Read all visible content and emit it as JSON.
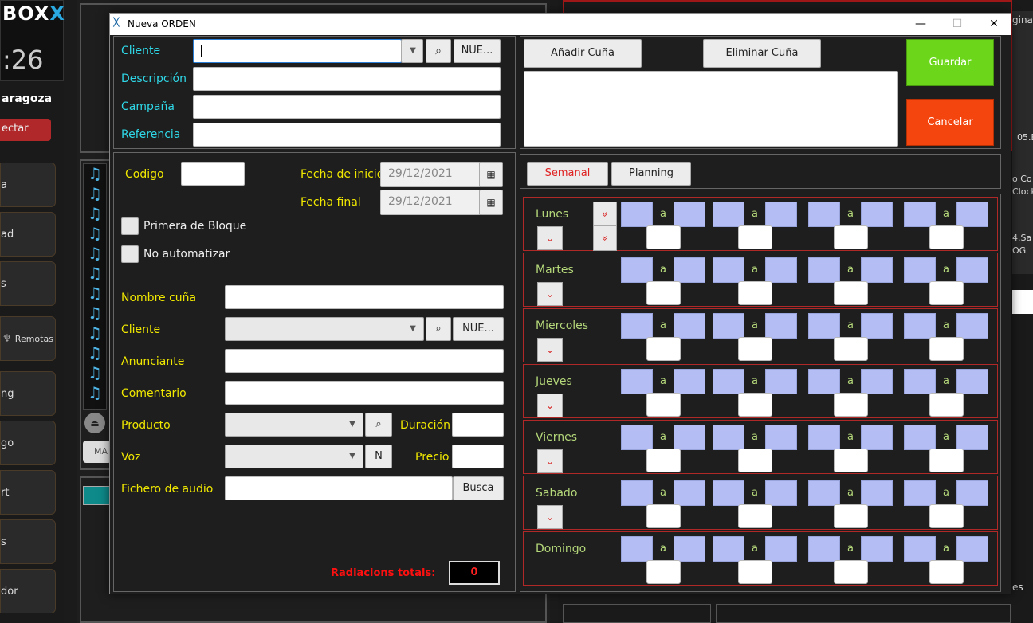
{
  "background": {
    "brand": "BOX",
    "brand_x": "X",
    "clock": ":26",
    "city": "aragoza",
    "connect": "ectar",
    "nav_items": [
      "a",
      "ad",
      "s",
      "Remotas",
      "ng",
      "go",
      "rt",
      "s",
      "dor"
    ],
    "right_texts": [
      "gina",
      "05.E",
      "o Co",
      "Clock",
      "4.Sa",
      "OG",
      "es"
    ],
    "ma_label": "MA"
  },
  "dialog": {
    "title": "Nueva ORDEN",
    "controls": {
      "minimize": "—",
      "maximize": "☐",
      "close": "✕"
    },
    "top": {
      "cliente_label": "Cliente",
      "descripcion_label": "Descripción",
      "campana_label": "Campaña",
      "referencia_label": "Referencia",
      "new_button": "NUE..."
    },
    "cunas": {
      "add_button": "Añadir Cuña",
      "remove_button": "Eliminar Cuña"
    },
    "actions": {
      "save": "Guardar",
      "cancel": "Cancelar"
    },
    "form": {
      "codigo_label": "Codigo",
      "fecha_inicio_label": "Fecha de inicio",
      "fecha_inicio": "29/12/2021",
      "fecha_final_label": "Fecha final",
      "fecha_final": "29/12/2021",
      "primera_bloque": "Primera de Bloque",
      "no_automatizar": "No automatizar",
      "nombre_cuna_label": "Nombre cuña",
      "cliente_label": "Cliente",
      "cliente_new_button": "NUE...",
      "anunciante_label": "Anunciante",
      "comentario_label": "Comentario",
      "producto_label": "Producto",
      "duracion_label": "Duración",
      "voz_label": "Voz",
      "voz_button": "N",
      "precio_label": "Precio",
      "fichero_label": "Fichero de audio",
      "busca_button": "Busca",
      "radiaciones_label": "Radiacions totals:",
      "radiaciones_value": "0"
    },
    "tabs": {
      "semanal": "Semanal",
      "planning": "Planning"
    },
    "days": [
      "Lunes",
      "Martes",
      "Miercoles",
      "Jueves",
      "Viernes",
      "Sabado",
      "Domingo"
    ],
    "a_label": "a"
  }
}
